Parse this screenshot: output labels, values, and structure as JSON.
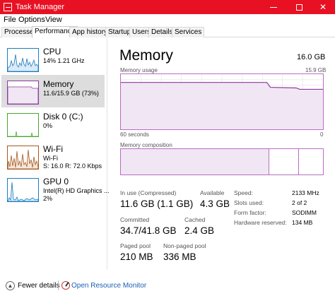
{
  "window": {
    "title": "Task Manager",
    "accent": "#e81123",
    "controls": {
      "minimize": "minimize",
      "maximize": "maximize",
      "close": "✕"
    }
  },
  "menu": [
    "File",
    "Options",
    "View"
  ],
  "tabs": [
    {
      "label": "Processes",
      "active": false
    },
    {
      "label": "Performance",
      "active": true
    },
    {
      "label": "App history",
      "active": false
    },
    {
      "label": "Startup",
      "active": false
    },
    {
      "label": "Users",
      "active": false
    },
    {
      "label": "Details",
      "active": false
    },
    {
      "label": "Services",
      "active": false
    }
  ],
  "resources": [
    {
      "name": "CPU",
      "sub": "14%  1.21 GHz",
      "color": "#1a7dc1",
      "fill": "#dbeaf7"
    },
    {
      "name": "Memory",
      "sub": "11.6/15.9 GB (73%)",
      "color": "#8b3a9e",
      "fill": "#f1e6f3"
    },
    {
      "name": "Disk 0 (C:)",
      "sub": "0%",
      "color": "#4aa52e",
      "fill": "#e3f2dc"
    },
    {
      "name": "Wi-Fi",
      "sub": "Wi-Fi",
      "sub2": "S: 16.0  R: 72.0 Kbps",
      "color": "#a7581f",
      "fill": "#f5e6da"
    },
    {
      "name": "GPU 0",
      "sub": "Intel(R) HD Graphics ...",
      "sub2": "2%",
      "color": "#1a7dc1",
      "fill": "#dbeaf7"
    }
  ],
  "memory": {
    "title": "Memory",
    "total": "16.0 GB",
    "usage_label": "Memory usage",
    "usage_max": "15.9 GB",
    "time_label": "60 seconds",
    "zero_label": "0",
    "composition_label": "Memory composition",
    "line_color": "#8b3a9e",
    "composition": {
      "in_use_fraction": 0.73,
      "modified_fraction": 0.146,
      "standby_fraction": 0.13
    },
    "stats": {
      "in_use_label": "In use (Compressed)",
      "in_use_value": "11.6 GB (1.1 GB)",
      "available_label": "Available",
      "available_value": "4.3 GB",
      "committed_label": "Committed",
      "committed_value": "34.7/41.8 GB",
      "cached_label": "Cached",
      "cached_value": "2.4 GB",
      "paged_label": "Paged pool",
      "paged_value": "210 MB",
      "nonpaged_label": "Non-paged pool",
      "nonpaged_value": "336 MB"
    },
    "hardware": [
      {
        "label": "Speed:",
        "value": "2133 MHz"
      },
      {
        "label": "Slots used:",
        "value": "2 of 2"
      },
      {
        "label": "Form factor:",
        "value": "SODIMM"
      },
      {
        "label": "Hardware reserved:",
        "value": "134 MB"
      }
    ]
  },
  "footer": {
    "fewer_details": "Fewer details",
    "open_resource_monitor": "Open Resource Monitor"
  },
  "icons": {
    "fewer": "chevron-up-icon",
    "resource_monitor": "resource-monitor-icon"
  }
}
